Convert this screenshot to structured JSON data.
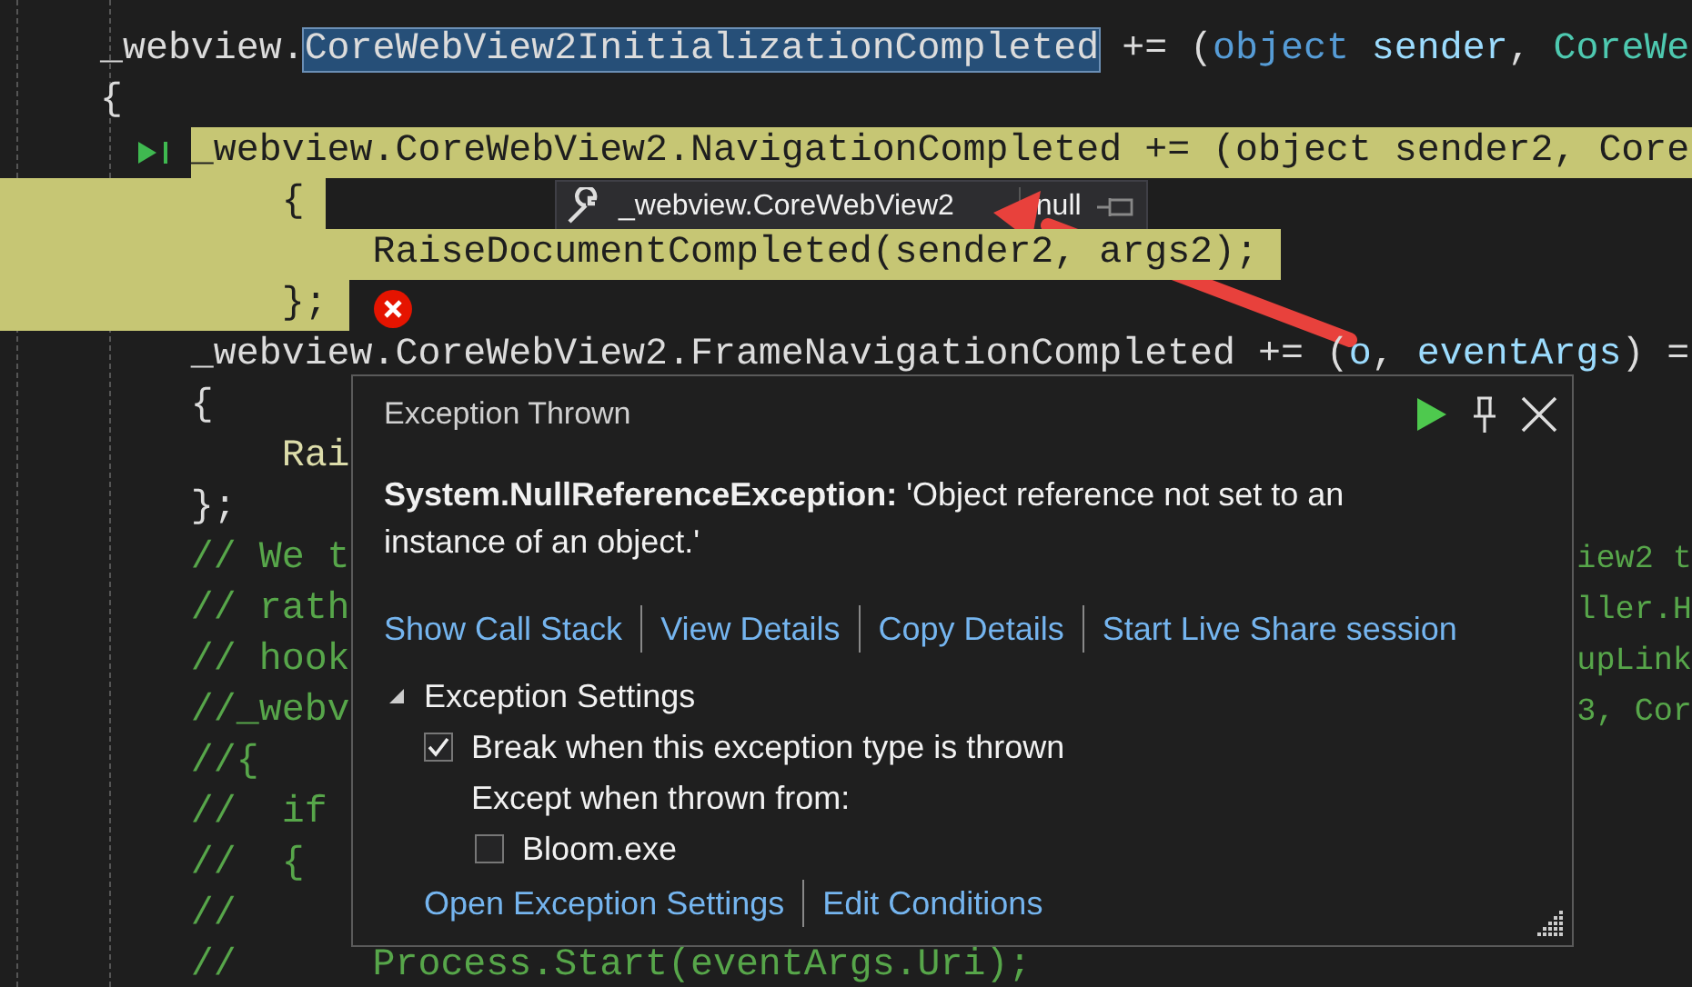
{
  "editor": {
    "lines": [
      {
        "current": false,
        "next_statement": false,
        "tokens": [
          {
            "text": "_webview.",
            "kind": "plain"
          },
          {
            "text": "CoreWebView2InitializationCompleted",
            "kind": "selection"
          },
          {
            "text": " += (",
            "kind": "plain"
          },
          {
            "text": "object",
            "kind": "keyword"
          },
          {
            "text": " sender",
            "kind": "param"
          },
          {
            "text": ", ",
            "kind": "plain"
          },
          {
            "text": "CoreWe",
            "kind": "type"
          }
        ]
      },
      {
        "current": false,
        "next_statement": false,
        "tokens": [
          {
            "text": "{",
            "kind": "plain"
          }
        ]
      },
      {
        "current": true,
        "next_statement": true,
        "tokens": [
          {
            "text": "    _webview.CoreWebView2.NavigationCompleted += (object sender2, Core",
            "kind": "plain"
          }
        ]
      },
      {
        "current": true,
        "next_statement": false,
        "tokens": [
          {
            "text": "        {",
            "kind": "plain"
          }
        ]
      },
      {
        "current": true,
        "next_statement": false,
        "tokens": [
          {
            "text": "            RaiseDocumentCompleted(sender2, args2);",
            "kind": "plain"
          }
        ]
      },
      {
        "current": true,
        "next_statement": false,
        "tokens": [
          {
            "text": "        };",
            "kind": "plain"
          }
        ]
      },
      {
        "current": false,
        "next_statement": false,
        "tokens": [
          {
            "text": "    _webview.CoreWebView2.FrameNavigationCompleted += (",
            "kind": "plain"
          },
          {
            "text": "o",
            "kind": "param"
          },
          {
            "text": ", ",
            "kind": "plain"
          },
          {
            "text": "eventArgs",
            "kind": "param"
          },
          {
            "text": ") =",
            "kind": "plain"
          }
        ]
      },
      {
        "current": false,
        "next_statement": false,
        "tokens": [
          {
            "text": "    {",
            "kind": "plain"
          }
        ]
      },
      {
        "current": false,
        "next_statement": false,
        "tokens": [
          {
            "text": "        Rai",
            "kind": "method"
          }
        ]
      },
      {
        "current": false,
        "next_statement": false,
        "tokens": [
          {
            "text": "    };",
            "kind": "plain"
          }
        ]
      },
      {
        "current": false,
        "next_statement": false,
        "tokens": [
          {
            "text": "    // We t",
            "kind": "comment"
          }
        ],
        "right": [
          {
            "text": "iew2 t",
            "kind": "comment"
          }
        ]
      },
      {
        "current": false,
        "next_statement": false,
        "tokens": [
          {
            "text": "    // rath",
            "kind": "comment"
          }
        ],
        "right": [
          {
            "text": "ller.H",
            "kind": "comment"
          }
        ]
      },
      {
        "current": false,
        "next_statement": false,
        "tokens": [
          {
            "text": "    // hook",
            "kind": "comment"
          }
        ],
        "right": [
          {
            "text": "upLink",
            "kind": "comment"
          }
        ]
      },
      {
        "current": false,
        "next_statement": false,
        "tokens": [
          {
            "text": "    //_webv",
            "kind": "comment"
          }
        ],
        "right": [
          {
            "text": "3, Cor",
            "kind": "comment"
          }
        ]
      },
      {
        "current": false,
        "next_statement": false,
        "tokens": [
          {
            "text": "    //{",
            "kind": "comment"
          }
        ]
      },
      {
        "current": false,
        "next_statement": false,
        "tokens": [
          {
            "text": "    //  if",
            "kind": "comment"
          }
        ]
      },
      {
        "current": false,
        "next_statement": false,
        "tokens": [
          {
            "text": "    //  {",
            "kind": "comment"
          }
        ]
      },
      {
        "current": false,
        "next_statement": false,
        "tokens": [
          {
            "text": "    //",
            "kind": "comment"
          }
        ]
      },
      {
        "current": false,
        "next_statement": false,
        "tokens": [
          {
            "text": "    //      Process.Start(eventArgs.Uri);",
            "kind": "comment"
          }
        ]
      }
    ]
  },
  "datatip": {
    "expression": "_webview.CoreWebView2",
    "value": "null"
  },
  "exception_popup": {
    "title": "Exception Thrown",
    "message": "**System.NullReferenceException:** 'Object reference not set to an instance of an object.'",
    "links": [
      "Show Call Stack",
      "View Details",
      "Copy Details",
      "Start Live Share session"
    ],
    "settings": {
      "label": "Exception Settings",
      "expanded": true,
      "items": [
        {
          "kind": "checkbox",
          "label": "Break when this exception type is thrown",
          "checked": true
        },
        {
          "kind": "label",
          "label": "Except when thrown from:",
          "children": [
            {
              "kind": "checkbox",
              "label": "Bloom.exe",
              "checked": false
            }
          ]
        }
      ]
    },
    "footer_links": [
      "Open Exception Settings",
      "Edit Conditions"
    ]
  }
}
